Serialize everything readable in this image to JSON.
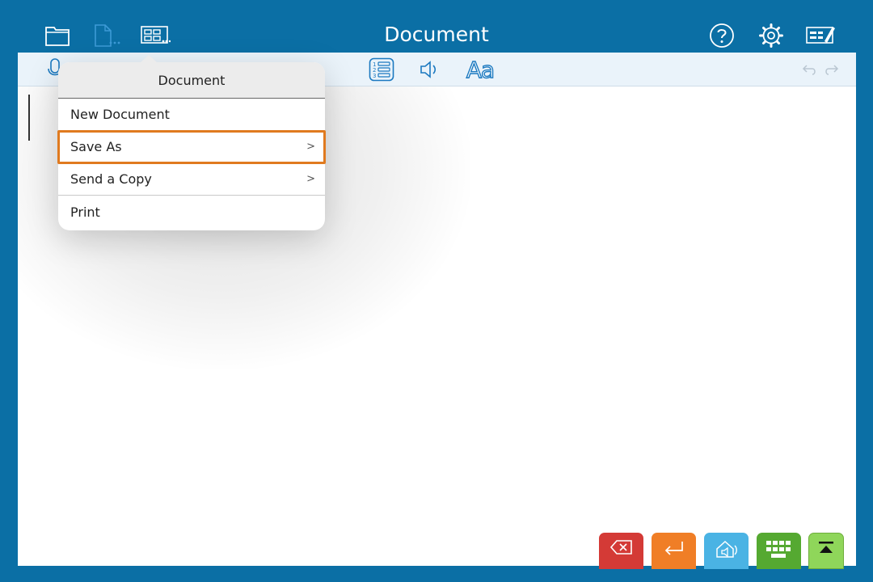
{
  "header": {
    "title": "Document",
    "icons": [
      "folder-icon",
      "document-options-icon",
      "layout-icon",
      "help-icon",
      "gear-icon",
      "edit-list-icon"
    ]
  },
  "toolbar": {
    "icons": [
      "microphone-icon",
      "numbered-list-icon",
      "speaker-icon",
      "undo-icon",
      "redo-icon"
    ],
    "font_label": "Aa"
  },
  "menu": {
    "title": "Document",
    "items": [
      {
        "label": "New Document",
        "chevron": ""
      },
      {
        "label": "Save As",
        "chevron": ">",
        "selected": true
      },
      {
        "label": "Send a Copy",
        "chevron": ">"
      },
      {
        "label": "Print",
        "chevron": ""
      }
    ]
  },
  "bottom_buttons": [
    {
      "icon": "backspace-icon",
      "color": "#d43a36"
    },
    {
      "icon": "return-icon",
      "color": "#f07e26"
    },
    {
      "icon": "speak-icon",
      "color": "#4ab3e4"
    },
    {
      "icon": "keyboard-icon",
      "color": "#55a931"
    },
    {
      "icon": "collapse-icon",
      "color": "#8fd65a"
    }
  ],
  "colors": {
    "background": "#0b6fa5",
    "toolbar": "#eaf3fa",
    "accent": "#1b79c0",
    "selection_outline": "#e07a1f"
  }
}
